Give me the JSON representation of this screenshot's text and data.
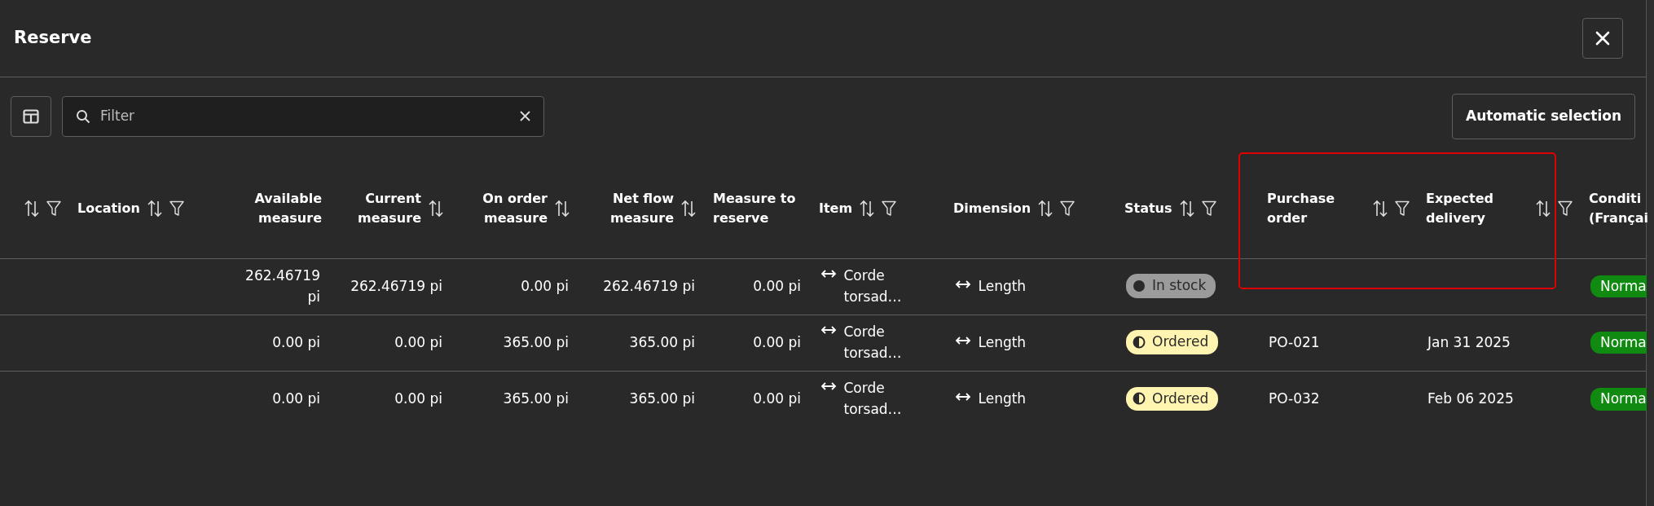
{
  "dialog": {
    "title": "Reserve"
  },
  "toolbar": {
    "filter": {
      "placeholder": "Filter"
    },
    "buttons": [
      "Automatic selection"
    ]
  },
  "table": {
    "columns": [
      {
        "sortable": true,
        "filterable": true
      },
      {
        "label": "Location",
        "sortable": true,
        "filterable": true
      },
      {
        "label": "Available measure",
        "sortable": false,
        "filterable": false
      },
      {
        "label": "Current measure",
        "sortable": true,
        "filterable": false
      },
      {
        "label": "On order measure",
        "sortable": true,
        "filterable": false
      },
      {
        "label": "Net flow measure",
        "sortable": true,
        "filterable": false
      },
      {
        "label": "Measure to reserve",
        "sortable": false,
        "filterable": false
      },
      {
        "label": "Item",
        "sortable": true,
        "filterable": true
      },
      {
        "label": "Dimension",
        "sortable": true,
        "filterable": true
      },
      {
        "label": "Status",
        "sortable": true,
        "filterable": true
      },
      {
        "label": "Purchase order",
        "sortable": true,
        "filterable": true
      },
      {
        "label": "Expected delivery",
        "sortable": true,
        "filterable": true
      },
      {
        "label": "Conditi (Françai",
        "sortable": false,
        "filterable": false
      }
    ],
    "rows": [
      {
        "cells": [
          null,
          null,
          {
            "kind": "number",
            "text": "262.46719 pi"
          },
          {
            "kind": "number",
            "text": "262.46719 pi"
          },
          {
            "kind": "number",
            "text": "0.00 pi"
          },
          {
            "kind": "number",
            "text": "262.46719 pi"
          },
          {
            "kind": "number",
            "text": "0.00 pi"
          },
          {
            "kind": "item",
            "text": "Corde torsad…"
          },
          {
            "kind": "item",
            "text": "Length"
          },
          {
            "kind": "status",
            "badge": {
              "kind": "in_stock",
              "text": "In stock"
            }
          },
          null,
          null,
          {
            "kind": "badge",
            "text": "Norma"
          }
        ]
      },
      {
        "cells": [
          null,
          null,
          {
            "kind": "number",
            "text": "0.00 pi"
          },
          {
            "kind": "number",
            "text": "0.00 pi"
          },
          {
            "kind": "number",
            "text": "365.00 pi"
          },
          {
            "kind": "number",
            "text": "365.00 pi"
          },
          {
            "kind": "number",
            "text": "0.00 pi"
          },
          {
            "kind": "item",
            "text": "Corde torsad…"
          },
          {
            "kind": "item",
            "text": "Length"
          },
          {
            "kind": "status",
            "badge": {
              "kind": "ordered",
              "text": "Ordered"
            }
          },
          {
            "kind": "text",
            "text": "PO-021"
          },
          {
            "kind": "text",
            "text": "Jan 31 2025"
          },
          {
            "kind": "badge",
            "text": "Norma"
          }
        ]
      },
      {
        "cells": [
          null,
          null,
          {
            "kind": "number",
            "text": "0.00 pi"
          },
          {
            "kind": "number",
            "text": "0.00 pi"
          },
          {
            "kind": "number",
            "text": "365.00 pi"
          },
          {
            "kind": "number",
            "text": "365.00 pi"
          },
          {
            "kind": "number",
            "text": "0.00 pi"
          },
          {
            "kind": "item",
            "text": "Corde torsad…"
          },
          {
            "kind": "item",
            "text": "Length"
          },
          {
            "kind": "status",
            "badge": {
              "kind": "ordered",
              "text": "Ordered"
            }
          },
          {
            "kind": "text",
            "text": "PO-032"
          },
          {
            "kind": "text",
            "text": "Feb 06 2025"
          },
          {
            "kind": "badge",
            "text": "Norma"
          }
        ]
      }
    ]
  }
}
